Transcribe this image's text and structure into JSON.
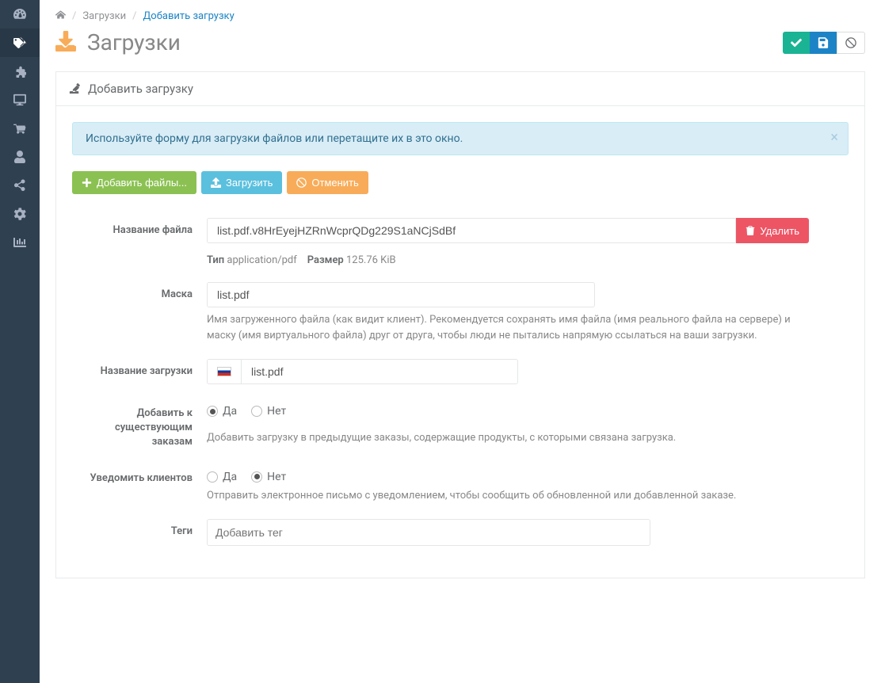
{
  "breadcrumb": {
    "home": "Главная",
    "parent": "Загрузки",
    "current": "Добавить загрузку"
  },
  "page": {
    "title": "Загрузки"
  },
  "panel": {
    "title": "Добавить загрузку"
  },
  "alert": {
    "text": "Используйте форму для загрузки файлов или перетащите их в это окно."
  },
  "upload_actions": {
    "add_files": "Добавить файлы...",
    "upload": "Загрузить",
    "cancel": "Отменить"
  },
  "form": {
    "filename": {
      "label": "Название файла",
      "value": "list.pdf.v8HrEyejHZRnWcprQDg229S1aNCjSdBf",
      "delete": "Удалить",
      "type_label": "Тип",
      "type_value": "application/pdf",
      "size_label": "Размер",
      "size_value": "125.76 KiB"
    },
    "mask": {
      "label": "Маска",
      "value": "list.pdf",
      "help": "Имя загруженного файла (как видит клиент). Рекомендуется сохранять имя файла (имя реального файла на сервере) и маску (имя виртуального файла) друг от друга, чтобы люди не пытались напрямую ссылаться на ваши загрузки."
    },
    "download_name": {
      "label": "Название загрузки",
      "value": "list.pdf"
    },
    "add_to_orders": {
      "label": "Добавить к существующим заказам",
      "yes": "Да",
      "no": "Нет",
      "help": "Добавить загрузку в предыдущие заказы, содержащие продукты, с которыми связана загрузка."
    },
    "notify": {
      "label": "Уведомить клиентов",
      "yes": "Да",
      "no": "Нет",
      "help": "Отправить электронное письмо с уведомлением, чтобы сообщить об обновленной или добавленной заказе."
    },
    "tags": {
      "label": "Теги",
      "placeholder": "Добавить тег"
    }
  }
}
